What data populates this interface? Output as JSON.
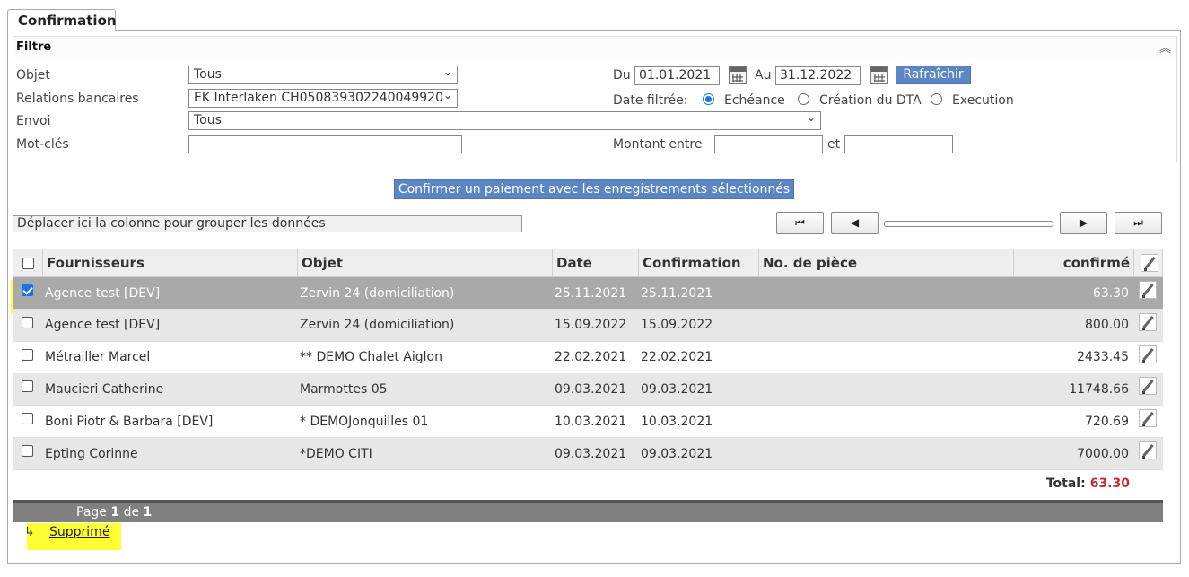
{
  "tab": {
    "label": "Confirmation"
  },
  "filter": {
    "title": "Filtre",
    "objet": {
      "label": "Objet",
      "value": "Tous"
    },
    "relations": {
      "label": "Relations bancaires",
      "value": "EK Interlaken CH050839302240049920"
    },
    "envoi": {
      "label": "Envoi",
      "value": "Tous"
    },
    "motcles": {
      "label": "Mot-clés",
      "value": ""
    },
    "du": {
      "label": "Du",
      "value": "01.01.2021"
    },
    "au": {
      "label": "Au",
      "value": "31.12.2022"
    },
    "refresh_label": "Rafraîchir",
    "date_filtree": {
      "label": "Date filtrée:",
      "options": [
        "Echéance",
        "Création du DTA",
        "Execution"
      ],
      "selected": "Echéance"
    },
    "montant": {
      "label": "Montant entre",
      "and": "et",
      "from": "",
      "to": ""
    }
  },
  "confirm_button": "Confirmer un paiement avec les enregistrements sélectionnés",
  "group_bar": "Déplacer ici la colonne pour grouper les données",
  "pager_buttons": {
    "first": "⏮",
    "prev": "◀",
    "next": "▶",
    "last": "⏭"
  },
  "table": {
    "columns": [
      "Fournisseurs",
      "Objet",
      "Date",
      "Confirmation",
      "No. de pièce",
      "confirmé"
    ],
    "rows": [
      {
        "checked": true,
        "fournisseur": "Agence test [DEV]",
        "objet": "Zervin 24 (domiciliation)",
        "date": "25.11.2021",
        "confirmation": "25.11.2021",
        "piece": "",
        "confirme": "63.30"
      },
      {
        "checked": false,
        "fournisseur": "Agence test [DEV]",
        "objet": "Zervin 24 (domiciliation)",
        "date": "15.09.2022",
        "confirmation": "15.09.2022",
        "piece": "",
        "confirme": "800.00"
      },
      {
        "checked": false,
        "fournisseur": "Métrailler Marcel",
        "objet": "** DEMO Chalet Aiglon",
        "date": "22.02.2021",
        "confirmation": "22.02.2021",
        "piece": "",
        "confirme": "2433.45"
      },
      {
        "checked": false,
        "fournisseur": "Maucieri Catherine",
        "objet": "Marmottes 05",
        "date": "09.03.2021",
        "confirmation": "09.03.2021",
        "piece": "",
        "confirme": "11748.66"
      },
      {
        "checked": false,
        "fournisseur": "Boni Piotr & Barbara [DEV]",
        "objet": "* DEMOJonquilles 01",
        "date": "10.03.2021",
        "confirmation": "10.03.2021",
        "piece": "",
        "confirme": "720.69"
      },
      {
        "checked": false,
        "fournisseur": "Epting Corinne",
        "objet": "*DEMO CITI",
        "date": "09.03.2021",
        "confirmation": "09.03.2021",
        "piece": "",
        "confirme": "7000.00"
      }
    ],
    "total_label": "Total:",
    "total_value": "63.30"
  },
  "pager": {
    "prefix": "Page",
    "current": "1",
    "sep": "de",
    "total": "1"
  },
  "deleted": {
    "arrow": "↳",
    "label": "Supprimé"
  },
  "colors": {
    "accent": "#5b86c4",
    "selected_row": "#a9a9a9",
    "highlight": "#ffff33",
    "total": "#c03030"
  }
}
